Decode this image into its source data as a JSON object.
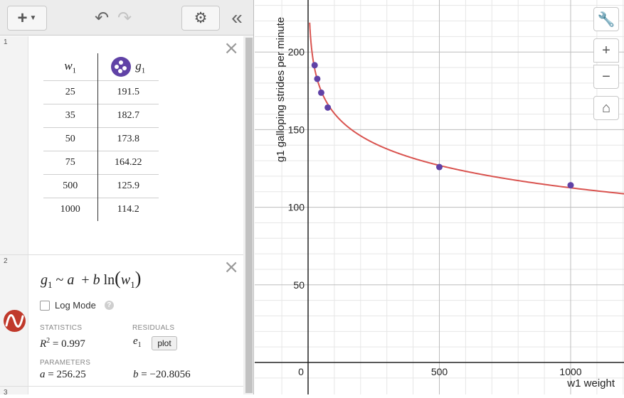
{
  "toolbar": {
    "add_icon": "plus-icon",
    "undo_icon": "undo-icon",
    "redo_icon": "redo-icon",
    "settings_icon": "gear-icon",
    "collapse_icon": "double-chevron-left-icon"
  },
  "expressions": [
    {
      "number": "1",
      "type": "table",
      "columns": [
        {
          "var": "w",
          "sub": "1"
        },
        {
          "var": "g",
          "sub": "1",
          "icon_color": "#6042a6"
        }
      ],
      "rows": [
        [
          "25",
          "191.5"
        ],
        [
          "35",
          "182.7"
        ],
        [
          "50",
          "173.8"
        ],
        [
          "75",
          "164.22"
        ],
        [
          "500",
          "125.9"
        ],
        [
          "1000",
          "114.2"
        ]
      ]
    },
    {
      "number": "2",
      "type": "regression",
      "formula": {
        "lhs": "g",
        "lhs_sub": "1",
        "tilde": "~",
        "a": "a",
        "plus": "+",
        "b": "b",
        "ln": "ln",
        "arg": "w",
        "arg_sub": "1"
      },
      "log_mode_label": "Log Mode",
      "log_mode_checked": false,
      "statistics_label": "STATISTICS",
      "r2_value": "0.997",
      "residuals_label": "RESIDUALS",
      "residual_var": "e",
      "residual_sub": "1",
      "plot_label": "plot",
      "parameters_label": "PARAMETERS",
      "a_value": "256.25",
      "b_value": "−20.8056",
      "color": "#c0392b"
    },
    {
      "number": "3"
    }
  ],
  "graph": {
    "ylabel": "g1 galloping strides per minute",
    "xlabel": "w1 weight",
    "x_ticks": [
      "0",
      "500",
      "1000"
    ],
    "y_ticks": [
      "50",
      "100",
      "150",
      "200"
    ],
    "buttons": [
      "wrench-icon",
      "zoom-in-icon",
      "zoom-out-icon",
      "home-icon"
    ],
    "point_color": "#6042a6",
    "curve_color": "#d9534f"
  },
  "chart_data": {
    "type": "scatter",
    "x": [
      25,
      35,
      50,
      75,
      500,
      1000
    ],
    "y": [
      191.5,
      182.7,
      173.8,
      164.22,
      125.9,
      114.2
    ],
    "xlabel": "w1 weight",
    "ylabel": "g1 galloping strides per minute",
    "xlim": [
      -200,
      1200
    ],
    "ylim": [
      -20,
      235
    ],
    "grid": true,
    "fit": {
      "model": "a + b ln(x)",
      "a": 256.25,
      "b": -20.8056
    }
  }
}
